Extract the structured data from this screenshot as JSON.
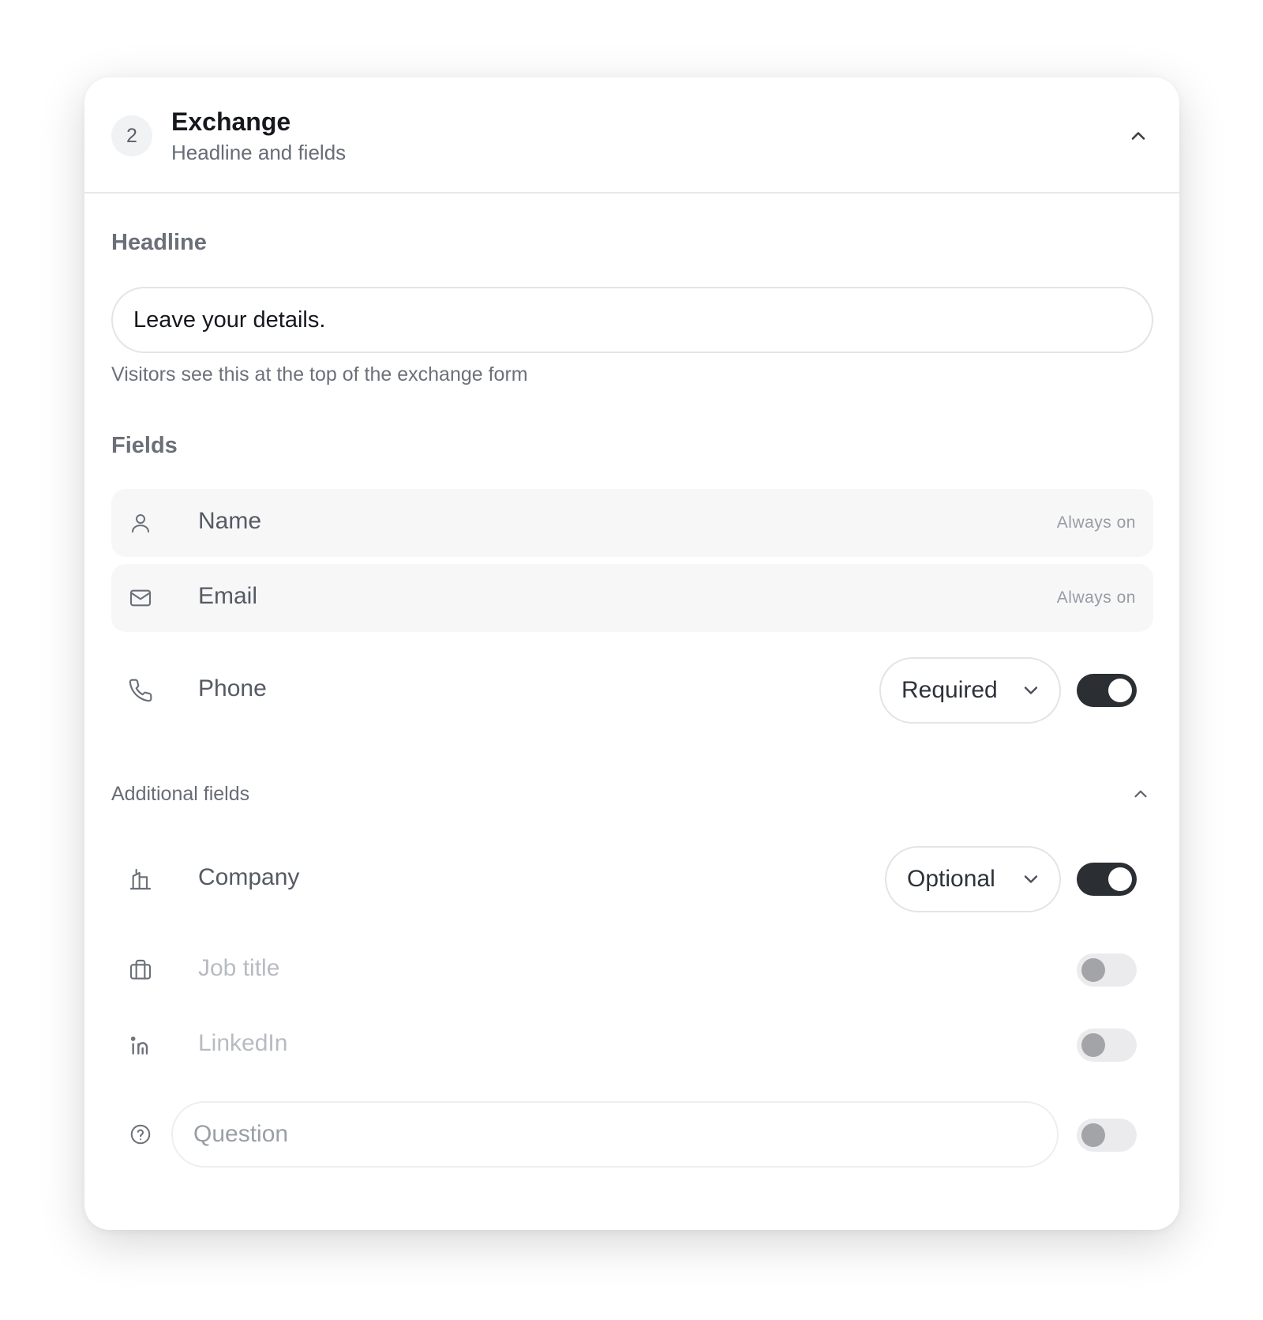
{
  "header": {
    "step_number": "2",
    "title": "Exchange",
    "subtitle": "Headline and fields",
    "chevron_icon": "chevron-up-icon"
  },
  "headline": {
    "label": "Headline",
    "value": "Leave your details.",
    "helper": "Visitors see this at the top of the exchange form"
  },
  "fields": {
    "label": "Fields",
    "name": {
      "label": "Name",
      "status": "Always on",
      "icon": "user-icon"
    },
    "email": {
      "label": "Email",
      "status": "Always on",
      "icon": "mail-icon"
    },
    "phone": {
      "label": "Phone",
      "mode": "Required",
      "enabled": true,
      "icon": "phone-icon"
    }
  },
  "additional": {
    "label": "Additional fields",
    "expanded": true,
    "company": {
      "label": "Company",
      "mode": "Optional",
      "enabled": true,
      "icon": "building-icon"
    },
    "job_title": {
      "label": "Job title",
      "enabled": false,
      "icon": "briefcase-icon"
    },
    "linkedin": {
      "label": "LinkedIn",
      "enabled": false,
      "icon": "linkedin-icon"
    },
    "question": {
      "placeholder": "Question",
      "enabled": false,
      "icon": "help-circle-icon"
    }
  },
  "colors": {
    "toggle_on": "#2b2e33",
    "toggle_off": "#ebebed",
    "row_bg": "#f7f7f8"
  }
}
